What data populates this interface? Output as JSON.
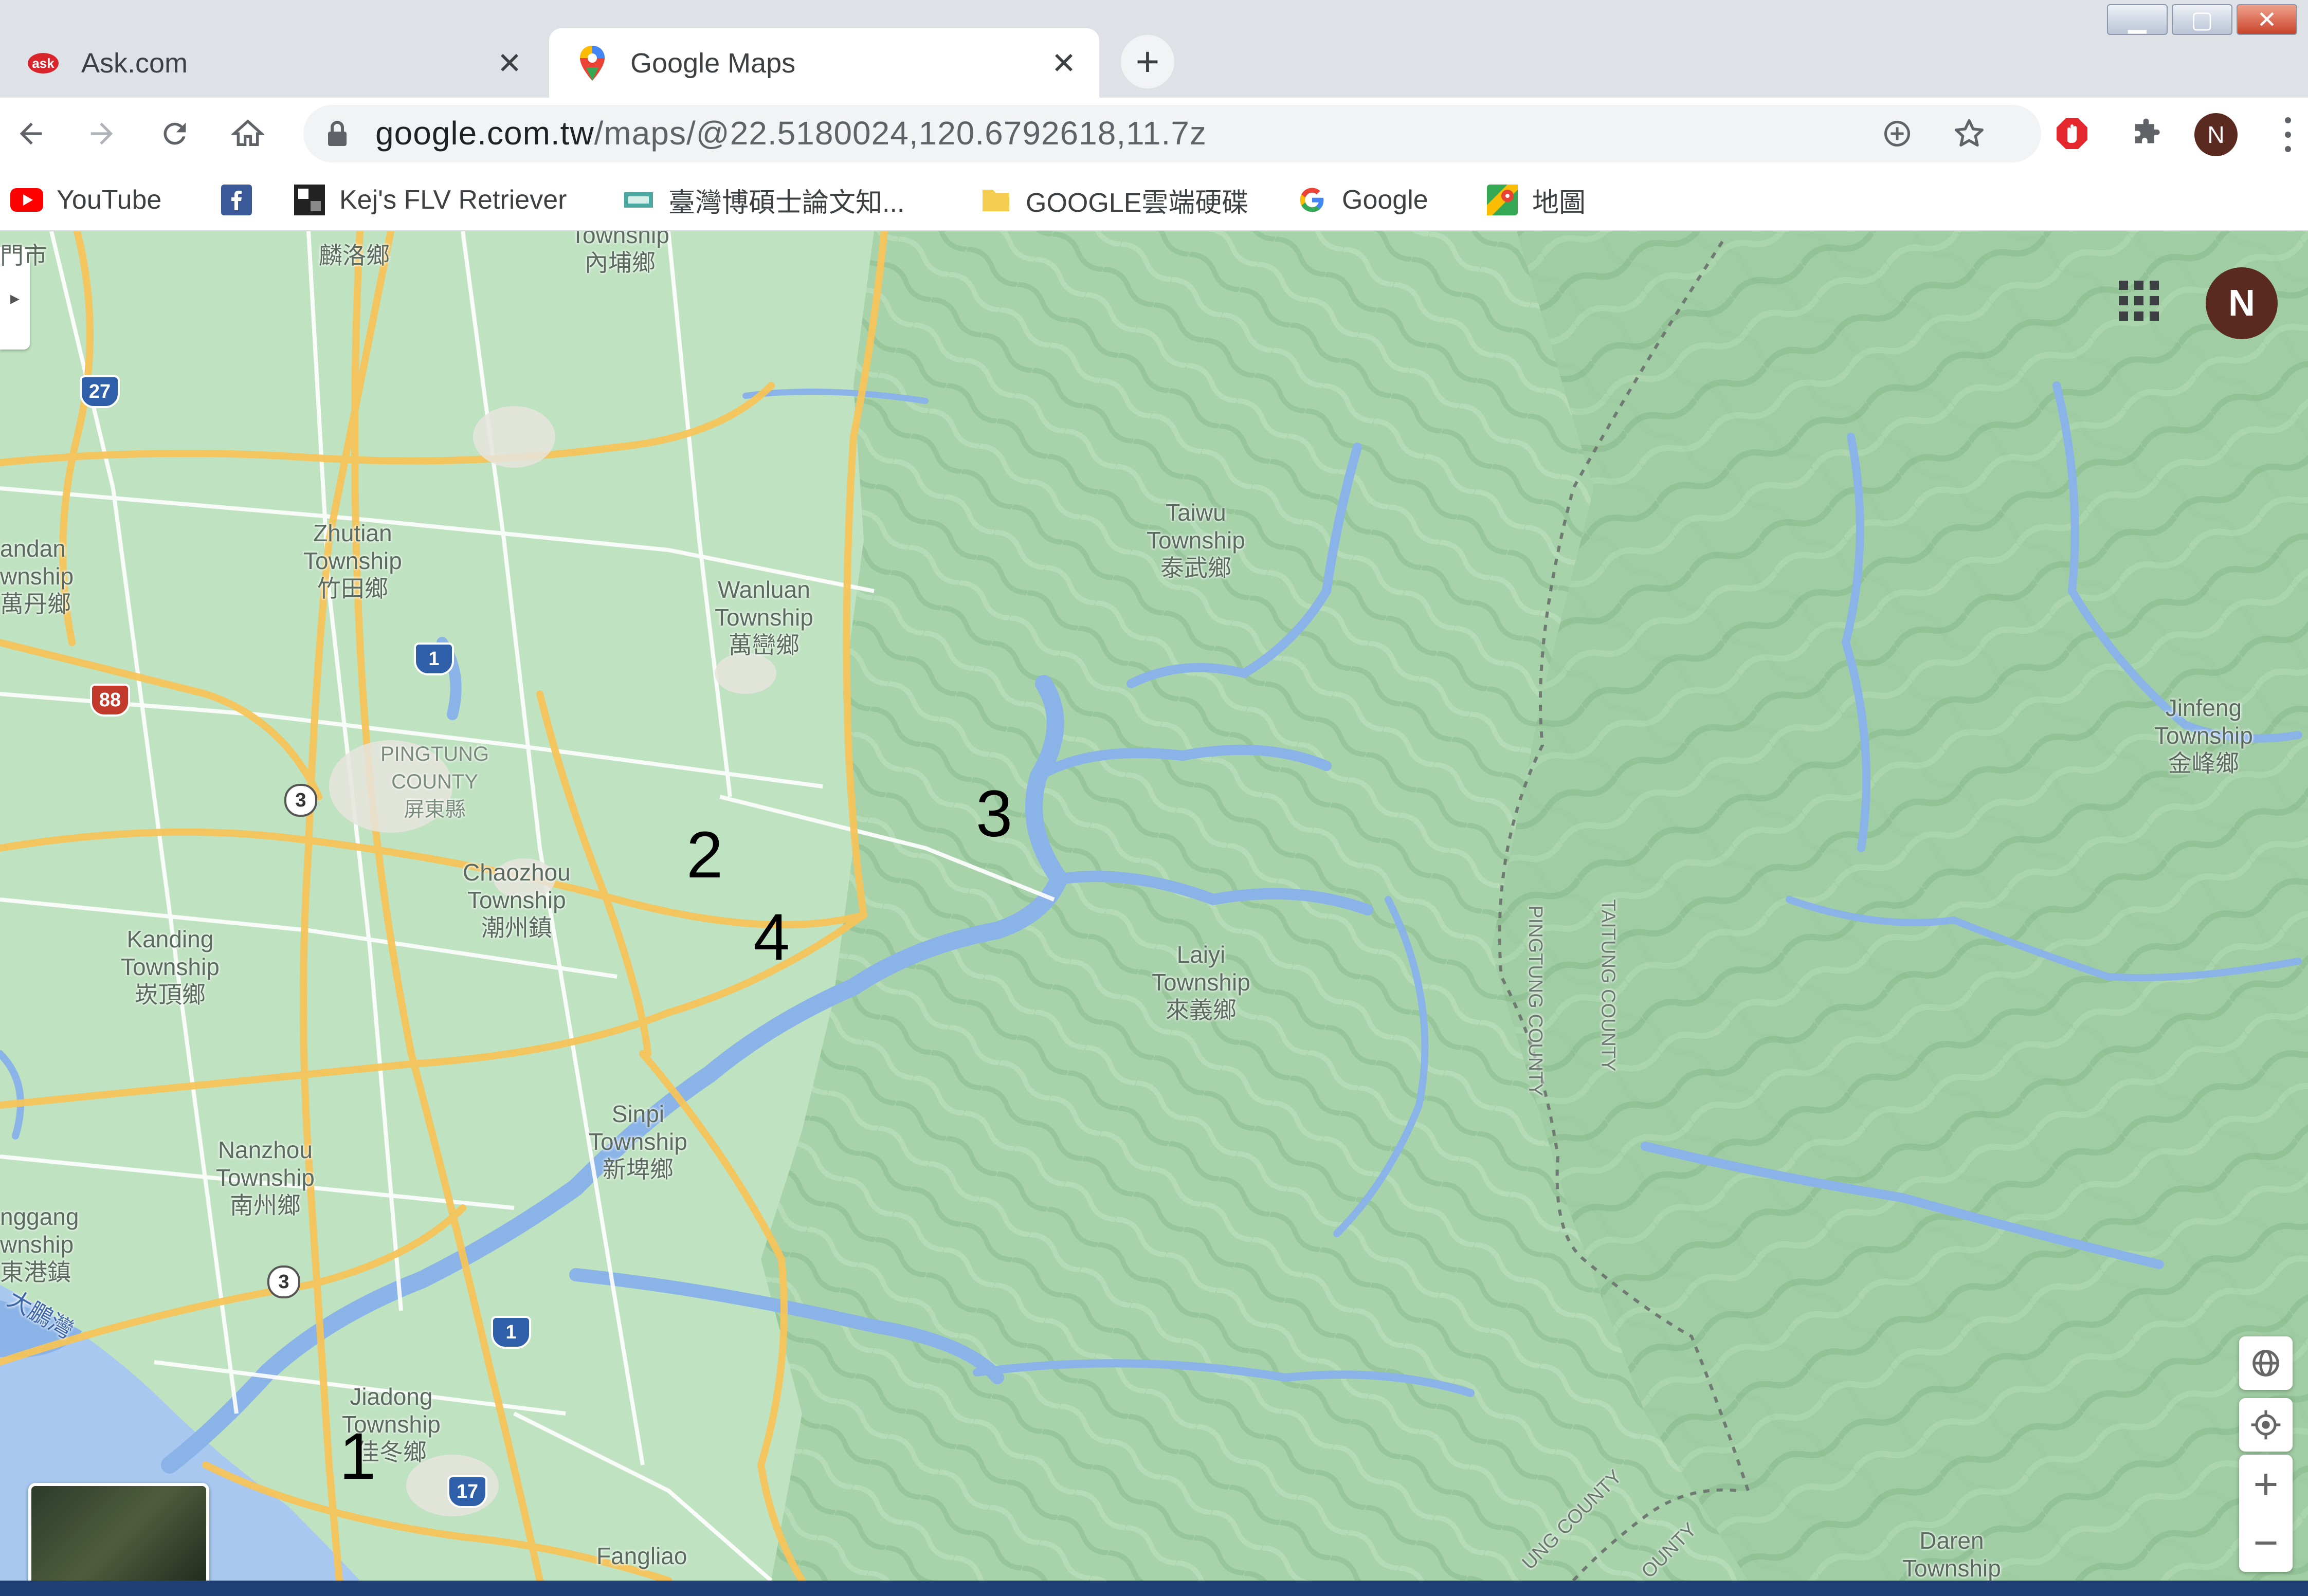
{
  "tabs": [
    {
      "title": "Ask.com",
      "favicon": "ask-logo-icon",
      "active": false
    },
    {
      "title": "Google Maps",
      "favicon": "google-maps-pin-icon",
      "active": true
    }
  ],
  "toolbar": {
    "url_host": "google.com.tw",
    "url_path": "/maps/@22.5180024,120.6792618,11.7z",
    "profile_initial": "N"
  },
  "bookmarks": [
    {
      "label": "YouTube",
      "icon": "youtube-icon"
    },
    {
      "label": "",
      "icon": "facebook-icon"
    },
    {
      "label": "Kej's FLV Retriever",
      "icon": "kej-icon"
    },
    {
      "label": "臺灣博碩士論文知...",
      "icon": "ncl-icon"
    },
    {
      "label": "GOOGLE雲端硬碟",
      "icon": "folder-icon"
    },
    {
      "label": "Google",
      "icon": "google-g-icon"
    },
    {
      "label": "地圖",
      "icon": "maps-icon"
    }
  ],
  "map": {
    "account_initial": "N",
    "labels": {
      "neipu": "Township\n內埔鄉",
      "changzhi_top": "麟洛鄉",
      "taiwu": "Taiwu\nTownship\n泰武鄉",
      "zhutian": "Zhutian\nTownship\n竹田鄉",
      "wanluan": "Wanluan\nTownship\n萬巒鄉",
      "wandan": "andan\nwnship\n萬丹鄉",
      "pingtung_county": "PINGTUNG\nCOUNTY\n屏東縣",
      "chaozhou": "Chaozhou\nTownship\n潮州鎮",
      "kanding": "Kanding\nTownship\n崁頂鄉",
      "laiyi": "Laiyi\nTownship\n來義鄉",
      "jinfeng": "Jinfeng\nTownship\n金峰鄉",
      "xinpi": "Sinpi\nTownship\n新埤鄉",
      "nanzhou": "Nanzhou\nTownship\n南州鄉",
      "donggang": "nggang\nwnship\n東港鎮",
      "jiadong": "Jiadong\nTownship\n佳冬鄉",
      "fangliao": "Fangliao",
      "daren": "Daren\nTownship",
      "city_top": "門市",
      "dapeng": "大鵬灣",
      "border_pingtung": "PINGTUNG COUNTY",
      "border_taitung": "TAITUNG COUNTY",
      "border_bottom1": "UNG COUNTY",
      "border_bottom2": "OUNTY"
    },
    "shields": {
      "s27": "27",
      "s1a": "1",
      "s88": "88",
      "s3a": "3",
      "s3b": "3",
      "s1b": "1",
      "s17": "17"
    },
    "markers": [
      "1",
      "2",
      "3",
      "4"
    ],
    "zoom_in": "+",
    "zoom_out": "−"
  },
  "colors": {
    "land": "#b6dcb8",
    "mountain": "#a3cfa6",
    "water": "#8ab4e8",
    "road_major": "#f5c45a",
    "road_minor": "#ffffff",
    "sea": "#a9c8f0"
  }
}
